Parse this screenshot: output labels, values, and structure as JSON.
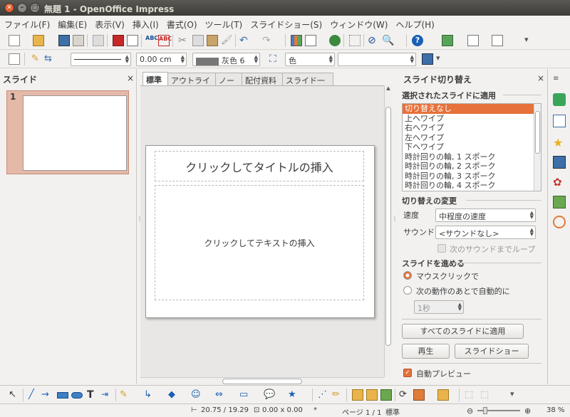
{
  "window": {
    "title": "無題 1 - OpenOffice Impress"
  },
  "menu": [
    "ファイル(F)",
    "編集(E)",
    "表示(V)",
    "挿入(I)",
    "書式(O)",
    "ツール(T)",
    "スライドショー(S)",
    "ウィンドウ(W)",
    "ヘルプ(H)"
  ],
  "line_toolbar": {
    "line_width": "0.00 cm",
    "area_color": "灰色 6",
    "area_style": "色"
  },
  "slides_panel": {
    "title": "スライド",
    "slide_number": "1"
  },
  "view_tabs": [
    "標準",
    "アウトライン",
    "ノート",
    "配付資料",
    "スライド一覧"
  ],
  "slide": {
    "title_placeholder": "クリックしてタイトルの挿入",
    "text_placeholder": "クリックしてテキストの挿入"
  },
  "transition_panel": {
    "title": "スライド切り替え",
    "apply_section": "選択されたスライドに適用",
    "transitions": [
      "切り替えなし",
      "上へワイプ",
      "右へワイプ",
      "左へワイプ",
      "下へワイプ",
      "時計回りの輪, 1 スポーク",
      "時計回りの輪, 2 スポーク",
      "時計回りの輪, 3 スポーク",
      "時計回りの輪, 4 スポーク"
    ],
    "modify_section": "切り替えの変更",
    "speed_label": "速度",
    "speed_value": "中程度の速度",
    "sound_label": "サウンド",
    "sound_value": "<サウンドなし>",
    "loop_label": "次のサウンドまでループ",
    "advance_section": "スライドを進める",
    "on_click_label": "マウスクリックで",
    "auto_label": "次の動作のあとで自動的に",
    "auto_time": "1秒",
    "apply_all_button": "すべてのスライドに適用",
    "play_button": "再生",
    "slideshow_button": "スライドショー",
    "auto_preview_label": "自動プレビュー"
  },
  "status": {
    "position": "20.75 / 19.29",
    "size": "0.00 x 0.00",
    "modified": "*",
    "page": "ページ 1 / 1",
    "layout": "標準",
    "zoom": "38 %"
  },
  "colors": {
    "accent": "#e6713a",
    "slide_selection": "#e5b9a8"
  }
}
